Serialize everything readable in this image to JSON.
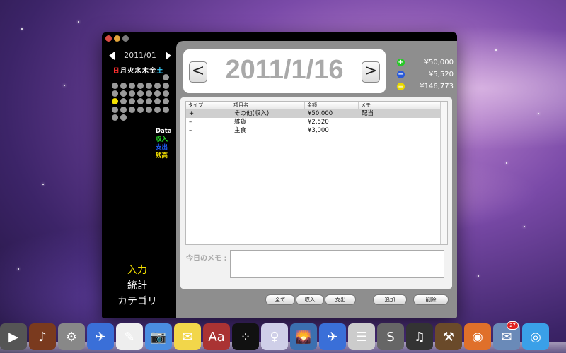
{
  "app": {
    "calendar": {
      "month_label": "2011/01",
      "weekdays": [
        {
          "label": "日",
          "color": "#ff3030"
        },
        {
          "label": "月",
          "color": "#ffffff"
        },
        {
          "label": "火",
          "color": "#ffffff"
        },
        {
          "label": "水",
          "color": "#ffffff"
        },
        {
          "label": "木",
          "color": "#ffffff"
        },
        {
          "label": "金",
          "color": "#ffffff"
        },
        {
          "label": "土",
          "color": "#3ad0ff"
        }
      ],
      "selected_day": 16
    },
    "legend": {
      "data": "Data",
      "income": "収入",
      "expense": "支出",
      "balance": "残高",
      "income_color": "#28e028",
      "expense_color": "#2060ff",
      "balance_color": "#f5e100"
    },
    "nav": {
      "input": "入力",
      "stats": "統計",
      "category": "カテゴリ",
      "active_color": "#f5e100"
    },
    "date": {
      "prev": "<",
      "next": ">",
      "current": "2011/1/16"
    },
    "totals": {
      "income": "¥50,000",
      "expense": "¥5,520",
      "balance": "¥146,773"
    },
    "table": {
      "headers": [
        "タイプ",
        "項目名",
        "金額",
        "メモ"
      ],
      "rows": [
        {
          "type": "+",
          "item": "その他(収入)",
          "amount": "¥50,000",
          "memo": "配当"
        },
        {
          "type": "–",
          "item": "雑貨",
          "amount": "¥2,520",
          "memo": ""
        },
        {
          "type": "–",
          "item": "主食",
          "amount": "¥3,000",
          "memo": ""
        }
      ]
    },
    "memo": {
      "label": "今日のメモ :",
      "value": ""
    },
    "buttons": {
      "all": "全て",
      "income": "収入",
      "expense": "支出",
      "add": "追加",
      "delete": "削除"
    }
  },
  "dock": {
    "icons": [
      "stack-icon",
      "guitar-icon",
      "system-preferences-icon",
      "xcode-icon",
      "textedit-icon",
      "preview-icon",
      "stickies-icon",
      "dictionary-icon",
      "app-dots-icon",
      "finder-ish-icon",
      "iphoto-icon",
      "xcode2-icon",
      "solution-menu-icon",
      "simulator-icon",
      "ipod-icon",
      "utility-icon",
      "firefox-icon",
      "mail-icon",
      "safari-icon"
    ],
    "mail_badge": "27"
  }
}
